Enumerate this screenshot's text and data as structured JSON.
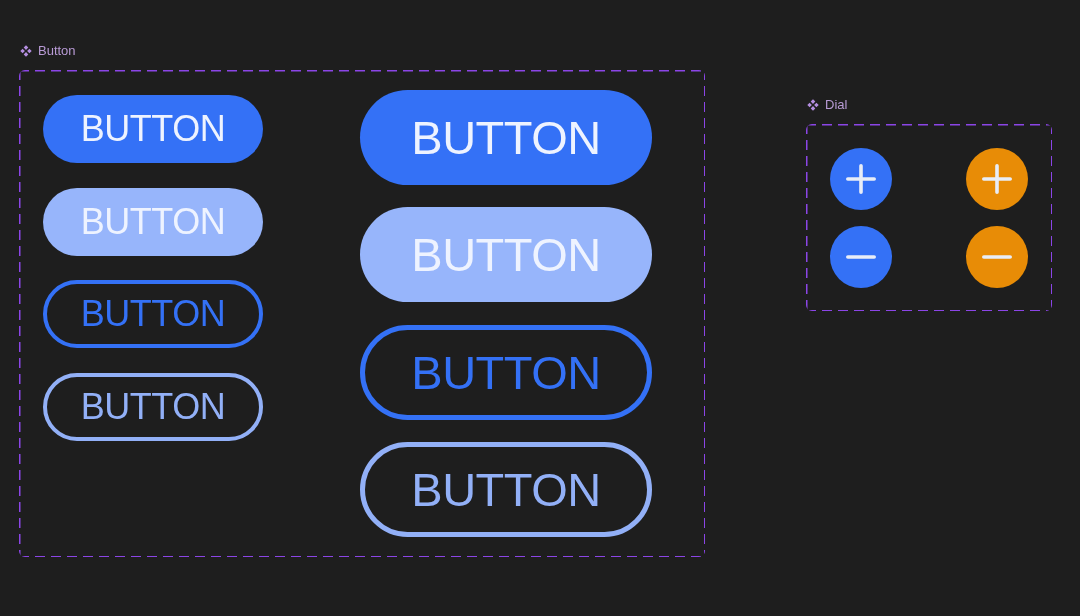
{
  "button_set": {
    "title": "Button",
    "sizes": [
      {
        "kind": "small",
        "buttons": [
          {
            "label": "BUTTON",
            "kind": "filled",
            "color": "#3471f6"
          },
          {
            "label": "BUTTON",
            "kind": "filled",
            "color": "#97b5fb"
          },
          {
            "label": "BUTTON",
            "kind": "outline",
            "color": "#3471f6"
          },
          {
            "label": "BUTTON",
            "kind": "outline",
            "color": "#92b0f7"
          }
        ]
      },
      {
        "kind": "large",
        "buttons": [
          {
            "label": "BUTTON",
            "kind": "filled",
            "color": "#3471f6"
          },
          {
            "label": "BUTTON",
            "kind": "filled",
            "color": "#97b5fb"
          },
          {
            "label": "BUTTON",
            "kind": "outline",
            "color": "#3471f6"
          },
          {
            "label": "BUTTON",
            "kind": "outline",
            "color": "#92b0f7"
          }
        ]
      }
    ]
  },
  "dial_set": {
    "title": "Dial",
    "buttons": [
      {
        "kind": "plus",
        "color": "#3471f6"
      },
      {
        "kind": "plus",
        "color": "#e88c06"
      },
      {
        "kind": "minus",
        "color": "#3471f6"
      },
      {
        "kind": "minus",
        "color": "#e88c06"
      }
    ]
  }
}
